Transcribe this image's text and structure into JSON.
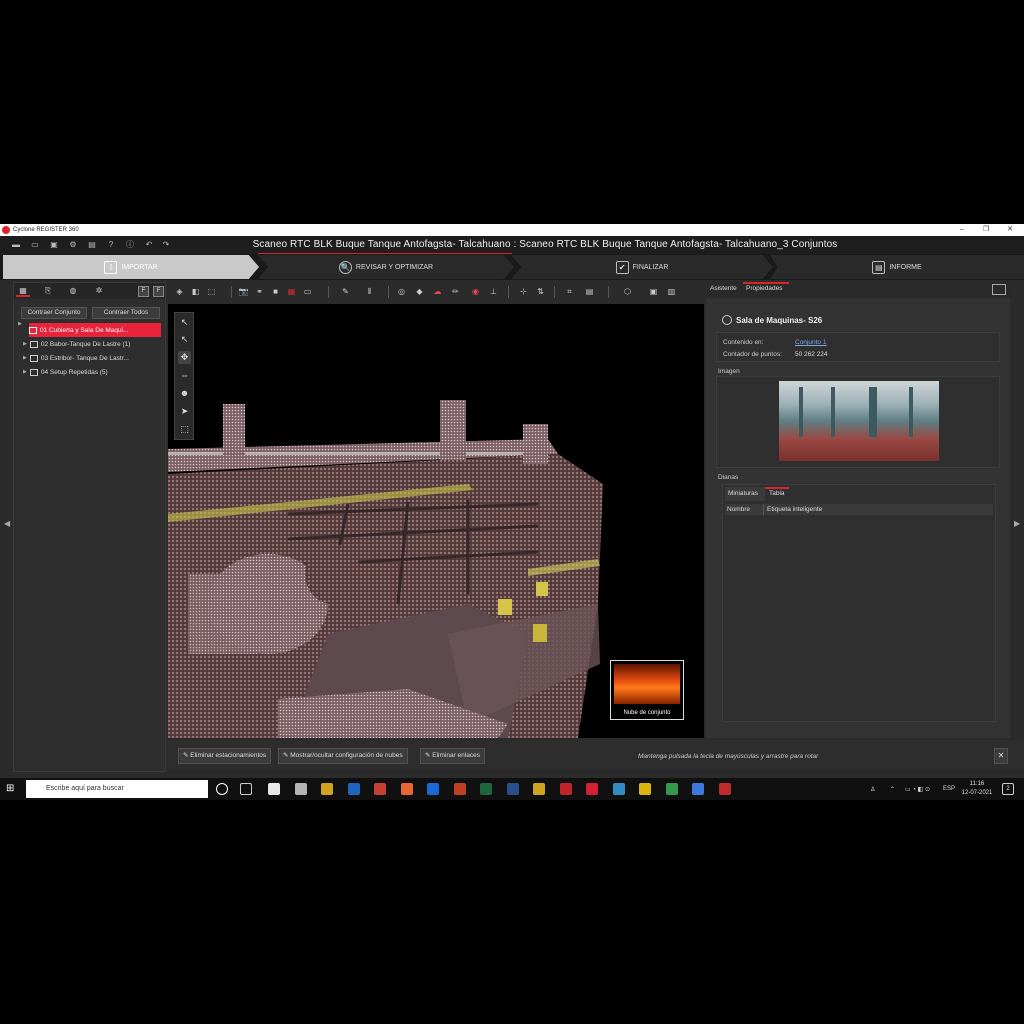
{
  "window": {
    "title": "Cyclone REGISTER 360",
    "min": "–",
    "max": "❐",
    "close": "✕"
  },
  "header": {
    "project_title": "Scaneo RTC BLK Buque Tanque Antofagsta- Talcahuano : Scaneo RTC BLK Buque Tanque Antofagsta- Talcahuano_3 Conjuntos",
    "quick_icons": [
      "▬",
      "▭",
      "▣",
      "⚙",
      "▤",
      "?",
      "ⓘ",
      "↶",
      "↷"
    ]
  },
  "workflow": {
    "steps": [
      {
        "label": "IMPORTAR",
        "icon": "⇩"
      },
      {
        "label": "REVISAR Y OPTIMIZAR",
        "icon": "🔍"
      },
      {
        "label": "FINALIZAR",
        "icon": "✔"
      },
      {
        "label": "INFORME",
        "icon": "▤"
      }
    ]
  },
  "left_panel": {
    "tab_icons": [
      "▦",
      "⎘",
      "◍",
      "✲"
    ],
    "tool_icons": [
      "F",
      "F"
    ],
    "collapse_set": "Contraer Conjunto",
    "collapse_all": "Contraer Todos",
    "tree": [
      {
        "label": "01 Cubierta y Sala De Maqui...",
        "selected": true
      },
      {
        "label": "02 Babor-Tanque De Lastre (1)",
        "selected": false
      },
      {
        "label": "03 Estribor- Tanque De Lastr...",
        "selected": false
      },
      {
        "label": "04 Setup Repetidas (5)",
        "selected": false
      }
    ]
  },
  "toolbar": {
    "icons": [
      "◈",
      "◧",
      "⬚",
      "▣",
      "📷",
      "⚭",
      "■",
      "▦",
      "▭",
      "✎",
      "⫴",
      "◎",
      "◆",
      "☁",
      "✏",
      "◉",
      "⊥",
      "⊹",
      "⇅",
      "⌗",
      "▤",
      "⬡",
      "▣",
      "▥"
    ]
  },
  "viewport": {
    "tool_icons": [
      "↖",
      "↖",
      "✥",
      "⇔",
      "☻",
      "➤",
      "⬚"
    ],
    "thumbnail_caption": "Nube de conjunto"
  },
  "bottom_bar": {
    "remove_stations": "Eliminar estacionamientos",
    "toggle_cloud_config": "Mostrar/ocultar configuración de nubes",
    "remove_links": "Eliminar enlaces",
    "hint": "Mantenga pulsada la tecla de mayúsculas y arrastre para rotar",
    "close": "✕"
  },
  "right_panel": {
    "tab_assistant": "Asistente",
    "tab_properties": "Propiedades",
    "object_title": "Sala de Maquinas- S26",
    "contained_in_label": "Contenido en:",
    "contained_in_value": "Conjunto 1",
    "point_count_label": "Contador de puntos:",
    "point_count_value": "50 262 224",
    "image_heading": "Imagen",
    "targets_heading": "Dianas",
    "targets_tabs": [
      "Miniaturas",
      "Tabla"
    ],
    "targets_columns": [
      "Nombre",
      "Etiqueta inteligente"
    ]
  },
  "taskbar": {
    "search_placeholder": "Escribe aquí para buscar",
    "lang": "ESP",
    "time": "11:16",
    "date": "12-07-2021",
    "app_colors": [
      "#ffffff",
      "#c8c8c8",
      "#e6b422",
      "#1f6fd1",
      "#db4437",
      "#ff7139",
      "#1a73e8",
      "#d24726",
      "#1d7044",
      "#2b579a",
      "#e6b422",
      "#d6262c",
      "#e8233a",
      "#3a9ad9",
      "#f2c811",
      "#34a853",
      "#4285f4",
      "#d32f2f"
    ]
  },
  "accent": "#d6262c"
}
